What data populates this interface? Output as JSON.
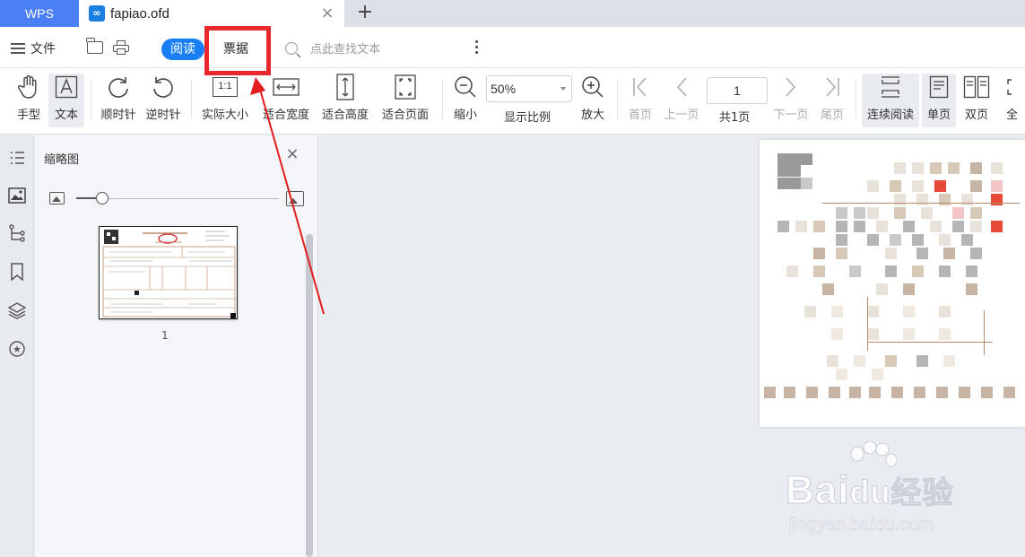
{
  "tabbar": {
    "app_tab": "WPS",
    "document_tab": "fapiao.ofd",
    "new_tab_glyph": "+",
    "close_glyph": "×"
  },
  "menubar": {
    "file_label": "文件",
    "read_tab": "阅读",
    "ticket_tab": "票据",
    "search_placeholder": "点此查找文本"
  },
  "ribbon": {
    "hand_tool": "手型",
    "text_tool": "文本",
    "rotate_cw": "顺时针",
    "rotate_ccw": "逆时针",
    "actual_size": "实际大小",
    "actual_size_icon_text": "1:1",
    "fit_width": "适合宽度",
    "fit_height": "适合高度",
    "fit_page": "适合页面",
    "zoom_out": "缩小",
    "zoom_value": "50%",
    "zoom_ratio_label": "显示比例",
    "zoom_in": "放大",
    "first_page": "首页",
    "prev_page": "上一页",
    "current_page": "1",
    "total_pages": "共1页",
    "next_page": "下一页",
    "last_page": "尾页",
    "continuous_read": "连续阅读",
    "single_page": "单页",
    "double_page": "双页",
    "fullscreen_partial": "全"
  },
  "thumbnail_panel": {
    "title": "缩略图",
    "page_number": "1"
  },
  "watermark": {
    "brand": "Bai",
    "brand2": "du",
    "brand_cn": "经验",
    "url": "jingyan.baidu.com"
  },
  "colors": {
    "accent": "#1a7ff5",
    "wps_tab": "#4a7ff5",
    "highlight": "#e8282b"
  }
}
